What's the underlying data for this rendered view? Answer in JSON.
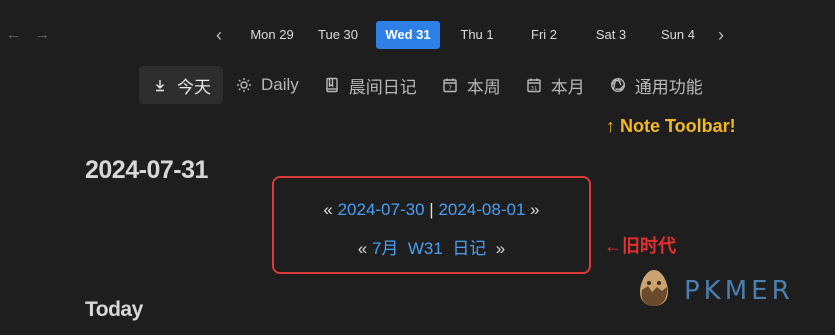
{
  "week": {
    "days": [
      "Mon 29",
      "Tue 30",
      "Wed 31",
      "Thu 1",
      "Fri 2",
      "Sat 3",
      "Sun 4"
    ],
    "active_index": 2,
    "prev_symbol": "‹",
    "next_symbol": "›"
  },
  "toolbar": {
    "items": [
      {
        "label": "今天",
        "icon": "download-arrow-icon",
        "active": true
      },
      {
        "label": "Daily",
        "icon": "sun-icon",
        "active": false
      },
      {
        "label": "晨间日记",
        "icon": "notebook-icon",
        "active": false
      },
      {
        "label": "本周",
        "icon": "calendar-7-icon",
        "active": false
      },
      {
        "label": "本月",
        "icon": "calendar-31-icon",
        "active": false
      },
      {
        "label": "通用功能",
        "icon": "aperture-icon",
        "active": false
      }
    ]
  },
  "annotations": {
    "toolbar_note": "↑ Note Toolbar!",
    "old_note": "←旧时代"
  },
  "note": {
    "date_title": "2024-07-31",
    "nav_line1": {
      "left": "«",
      "prev": "2024-07-30",
      "sep": "|",
      "next": "2024-08-01",
      "right": "»"
    },
    "nav_line2": {
      "left": "«",
      "month": "7月",
      "week": "W31",
      "diary": "日记",
      "right": "»"
    },
    "section_heading": "Today"
  },
  "watermark": {
    "text": "PKMER"
  },
  "colors": {
    "accent": "#2f80e6",
    "link": "#4a9ff5",
    "highlight_box": "#d93a3a",
    "annot_yellow": "#f3b823",
    "annot_red": "#e23030"
  }
}
